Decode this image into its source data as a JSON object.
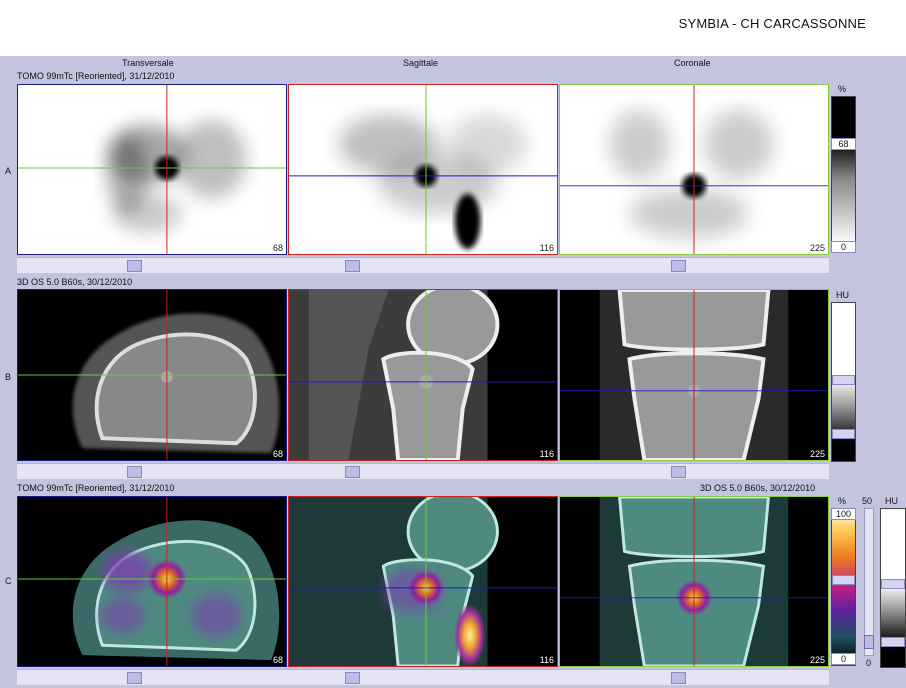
{
  "app_title": "SYMBIA - CH CARCASSONNE",
  "columns": [
    "Transversale",
    "Sagittale",
    "Coronale"
  ],
  "rows": {
    "A": {
      "label": "A",
      "series": "TOMO 99mTc [Reoriented], 31/12/2010",
      "slices": [
        "68",
        "116",
        "225"
      ],
      "scale": {
        "unit": "%",
        "top": "68",
        "bottom": "0"
      }
    },
    "B": {
      "label": "B",
      "series": "3D  OS  5.0  B60s, 30/12/2010",
      "slices": [
        "68",
        "116",
        "225"
      ],
      "scale": {
        "unit": "HU"
      }
    },
    "C": {
      "label": "C",
      "series_left": "TOMO 99mTc [Reoriented], 31/12/2010",
      "series_right": "3D  OS  5.0  B60s, 30/12/2010",
      "slices": [
        "68",
        "116",
        "225"
      ],
      "scale": {
        "unit": "%",
        "top": "100",
        "bottom": "0",
        "blend_top": "50",
        "blend_bottom": "0",
        "ct_unit": "HU"
      }
    }
  },
  "colors": {
    "workspace": "#c5c4e0",
    "transversal_frame": "#1a1a8a",
    "sagittal_frame": "#cc2222",
    "coronal_frame": "#88cc44"
  }
}
